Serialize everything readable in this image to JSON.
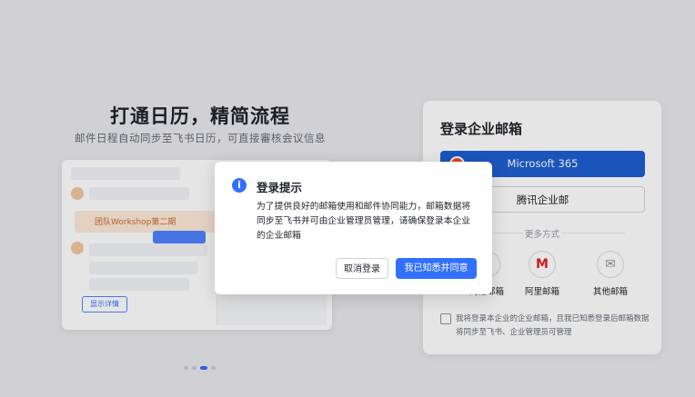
{
  "promo": {
    "title": "打通日历，精简流程",
    "subtitle": "邮件日程自动同步至飞书日历，可直接審核会议信息",
    "preview": {
      "card_text": "团队Workshop第二期",
      "chip_label": "显示详情"
    },
    "carousel": {
      "count": 4,
      "active_index": 2
    }
  },
  "login": {
    "title": "登录企业邮箱",
    "providers": [
      {
        "label": "Microsoft 365",
        "icon": "microsoft-logo-icon"
      },
      {
        "label": "腾讯企业邮"
      }
    ],
    "more_label": "更多方式",
    "more_options": [
      {
        "label": "网易邮箱",
        "icon": "netease-mail-icon"
      },
      {
        "label": "阿里邮箱",
        "icon": "aliyun-mail-icon"
      },
      {
        "label": "其他邮箱",
        "icon": "other-mail-icon"
      }
    ],
    "agreement": "我将登录本企业的企业邮箱，且我已知悉登录后邮箱数据将同步至飞书、企业管理员可管理"
  },
  "dialog": {
    "title": "登录提示",
    "body": "为了提供良好的邮箱使用和邮件协同能力，邮箱数据将同步至飞书并可由企业管理员管理，请确保登录本企业的企业邮箱",
    "cancel_label": "取消登录",
    "confirm_label": "我已知悉并同意",
    "icon": "info-icon"
  },
  "colors": {
    "accent": "#3370ff",
    "overlay": "rgba(0,0,0,0.10)"
  }
}
